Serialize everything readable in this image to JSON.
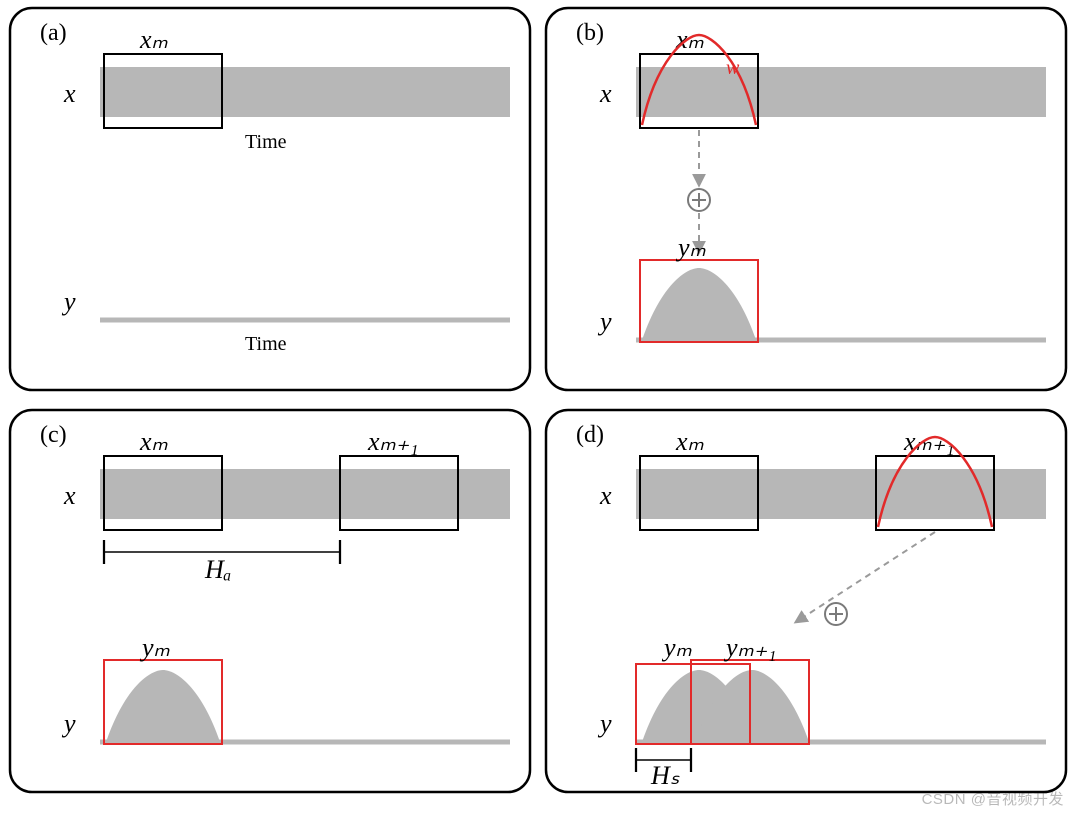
{
  "diagram": {
    "description": "Short-Time Fourier Transform (STFT) overlap-add analysis/synthesis illustration. A long signal x is segmented into frames x_m of length N, windowed by w, and summed (overlap-add) into output y. Analysis hop H_a and synthesis hop H_s between consecutive frames are shown.",
    "grid": {
      "rows": 2,
      "cols": 2
    },
    "colors": {
      "signal_band": "#b7b7b7",
      "baseline": "#b7b7b7",
      "frame_box": "#000000",
      "output_box": "#e22a2a",
      "window_curve": "#e22a2a",
      "arrow": "#9a9a9a",
      "circle_plus": "#7a7a7a"
    }
  },
  "panels": {
    "a": {
      "tag": "(a)",
      "x_label": "x",
      "y_label": "y",
      "time_label_top": "Time",
      "time_label_bottom": "Time",
      "frame_label": "xₘ"
    },
    "b": {
      "tag": "(b)",
      "x_label": "x",
      "y_label": "y",
      "frame_label": "xₘ",
      "window_label": "w",
      "output_frame_label": "yₘ",
      "operation": "circle-plus"
    },
    "c": {
      "tag": "(c)",
      "x_label": "x",
      "y_label": "y",
      "frame_label_1": "xₘ",
      "frame_label_2": "xₘ₊₁",
      "hop_label": "Hₐ",
      "output_frame_label": "yₘ"
    },
    "d": {
      "tag": "(d)",
      "x_label": "x",
      "y_label": "y",
      "frame_label_1": "xₘ",
      "frame_label_2": "xₘ₊₁",
      "output_frame_label_1": "yₘ",
      "output_frame_label_2": "yₘ₊₁",
      "hop_label": "Hₛ",
      "operation": "circle-plus"
    }
  },
  "watermark": "CSDN @音视频开发",
  "chart_data": {
    "type": "diagram",
    "signals": {
      "input": {
        "name": "x",
        "axis": "Time",
        "representation": "uniform gray band"
      },
      "output": {
        "name": "y",
        "axis": "Time",
        "representation": "overlap-added windowed frames on baseline"
      }
    },
    "frames": {
      "analysis": [
        {
          "id": "x_m"
        },
        {
          "id": "x_{m+1}"
        }
      ],
      "synthesis": [
        {
          "id": "y_m"
        },
        {
          "id": "y_{m+1}"
        }
      ]
    },
    "window": {
      "name": "w",
      "shape": "bell/Hann-like",
      "color": "red"
    },
    "hops": {
      "analysis_hop": {
        "symbol": "H_a",
        "between": [
          "x_m",
          "x_{m+1}"
        ],
        "shown_in": "c"
      },
      "synthesis_hop": {
        "symbol": "H_s",
        "between": [
          "y_m",
          "y_{m+1}"
        ],
        "shown_in": "d"
      }
    },
    "operation": "circled-plus (overlap-add accumulation)"
  }
}
